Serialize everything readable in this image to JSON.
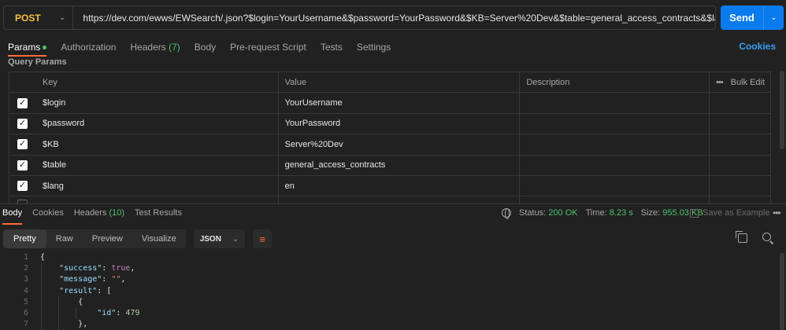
{
  "request": {
    "method": "POST",
    "url": "https://dev.com/ewws/EWSearch/.json?$login=YourUsername&$password=YourPassword&$KB=Server%20Dev&$table=general_access_contracts&$lang=en",
    "send_label": "Send"
  },
  "tabs": {
    "params": "Params",
    "authorization": "Authorization",
    "headers": "Headers",
    "headers_count": "(7)",
    "body": "Body",
    "pre_request": "Pre-request Script",
    "tests": "Tests",
    "settings": "Settings",
    "cookies": "Cookies"
  },
  "query_params": {
    "title": "Query Params",
    "columns": [
      "Key",
      "Value",
      "Description"
    ],
    "bulk_edit": "Bulk Edit",
    "rows": [
      {
        "key": "$login",
        "value": "YourUsername",
        "checked": true
      },
      {
        "key": "$password",
        "value": "YourPassword",
        "checked": true
      },
      {
        "key": "$KB",
        "value": "Server%20Dev",
        "checked": true
      },
      {
        "key": "$table",
        "value": "general_access_contracts",
        "checked": true
      },
      {
        "key": "$lang",
        "value": "en",
        "checked": true
      }
    ]
  },
  "response": {
    "tabs": {
      "body": "Body",
      "cookies": "Cookies",
      "headers": "Headers",
      "headers_count": "(10)",
      "test_results": "Test Results"
    },
    "status_label": "Status:",
    "status_value": "200 OK",
    "time_label": "Time:",
    "time_value": "8.23 s",
    "size_label": "Size:",
    "size_value": "955.03 KB",
    "save_example": "Save as Example",
    "views": [
      "Pretty",
      "Raw",
      "Preview",
      "Visualize"
    ],
    "format": "JSON",
    "code_lines": [
      "1",
      "2",
      "3",
      "4",
      "5",
      "6",
      "7"
    ],
    "code": {
      "l1": "{",
      "l2_key": "\"success\"",
      "l2_val": "true",
      "l3_key": "\"message\"",
      "l3_val": "\"\"",
      "l4_key": "\"result\"",
      "l4_val": "[",
      "l5": "{",
      "l6_key": "\"id\"",
      "l6_val": "479",
      "l7": "},"
    }
  },
  "colors": {
    "accent": "#ff6c37",
    "send": "#097bed",
    "method": "#f5c043",
    "success": "#4cc26a",
    "link": "#3b9ef5"
  }
}
